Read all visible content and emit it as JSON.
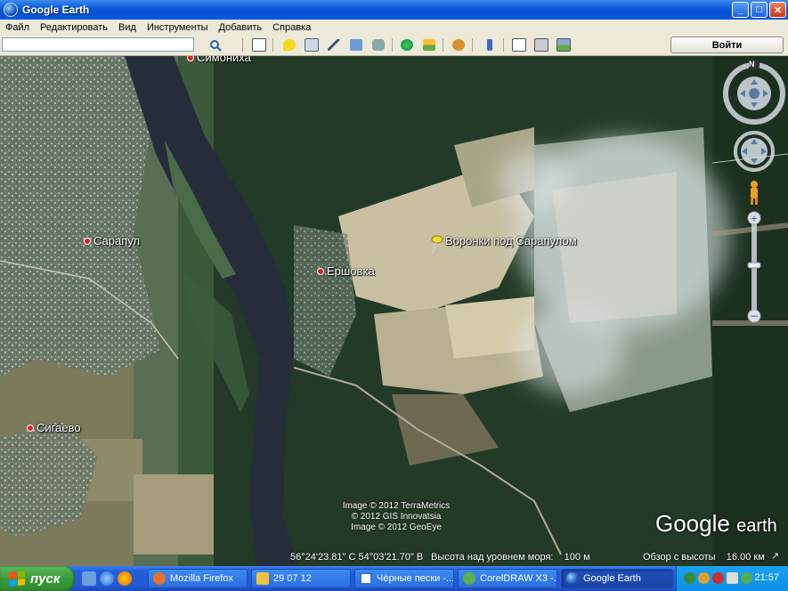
{
  "window": {
    "title": "Google Earth",
    "buttons": [
      "minimize",
      "maximize",
      "close"
    ]
  },
  "menu": [
    "Файл",
    "Редактировать",
    "Вид",
    "Инструменты",
    "Добавить",
    "Справка"
  ],
  "toolbar": {
    "search_value": "",
    "signin_label": "Войти",
    "icons": [
      "search-icon",
      "sidebar-toggle-icon",
      "add-placemark-icon",
      "add-polygon-icon",
      "add-path-icon",
      "add-image-overlay-icon",
      "record-tour-icon",
      "historical-imagery-icon",
      "sunlight-icon",
      "switch-to-sky-icon",
      "ruler-icon",
      "email-icon",
      "print-icon",
      "save-image-icon"
    ]
  },
  "map": {
    "places": [
      {
        "name": "Симониха"
      },
      {
        "name": "Сарапул"
      },
      {
        "name": "Ершовка"
      },
      {
        "name": "Сигаево"
      }
    ],
    "placemark": {
      "label": "Воронки под Сарапулом",
      "color": "#f4e020"
    },
    "credits": [
      "Image © 2012 TerraMetrics",
      "© 2012 GIS Innovatsia",
      "Image © 2012 GeoEye"
    ],
    "logo": {
      "google": "Google",
      "earth": "earth"
    },
    "compass_label": "N"
  },
  "status": {
    "coords": "56°24'23.81\" С  54°03'21.70\" В",
    "elevation": "Высота над уровнем моря:    100 м",
    "eye_alt": "Обзор с высоты    16.00 км"
  },
  "taskbar": {
    "start_label": "пуск",
    "tasks": [
      {
        "label": "Mozilla Firefox",
        "icon_color": "#e8702a",
        "active": false
      },
      {
        "label": "29 07 12",
        "icon_color": "#f0c040",
        "active": false
      },
      {
        "label": "Чёрные пески -...",
        "icon_color": "#3a6ad8",
        "active": false
      },
      {
        "label": "CorelDRAW X3 -...",
        "icon_color": "#5ab04a",
        "active": false
      },
      {
        "label": "Google Earth",
        "icon_color": "#2a6ac8",
        "active": true
      }
    ],
    "clock": "21:57"
  }
}
